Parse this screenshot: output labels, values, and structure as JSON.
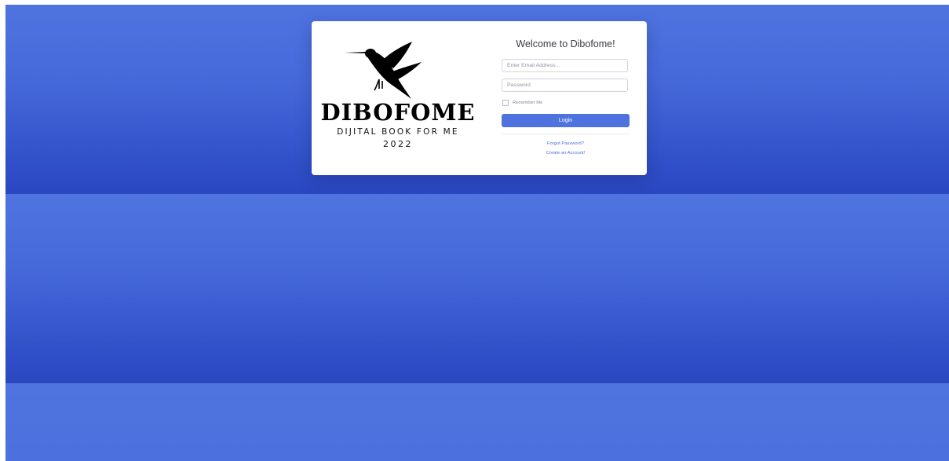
{
  "brand": {
    "logo_word": "DIBOFOME",
    "tagline": "DIJITAL BOOK FOR ME",
    "year": "2022",
    "bird_icon": "hummingbird-icon"
  },
  "login": {
    "title": "Welcome to Dibofome!",
    "email_placeholder": "Enter Email Address...",
    "password_placeholder": "Password",
    "remember_label": "Remember Me",
    "login_label": "Login",
    "forgot_link": "Forgot Password?",
    "create_link": "Create an Account!"
  },
  "colors": {
    "primary": "#4e73df",
    "background_top": "#4f74df",
    "background_bottom": "#2a47c0",
    "text_muted": "#858796"
  }
}
